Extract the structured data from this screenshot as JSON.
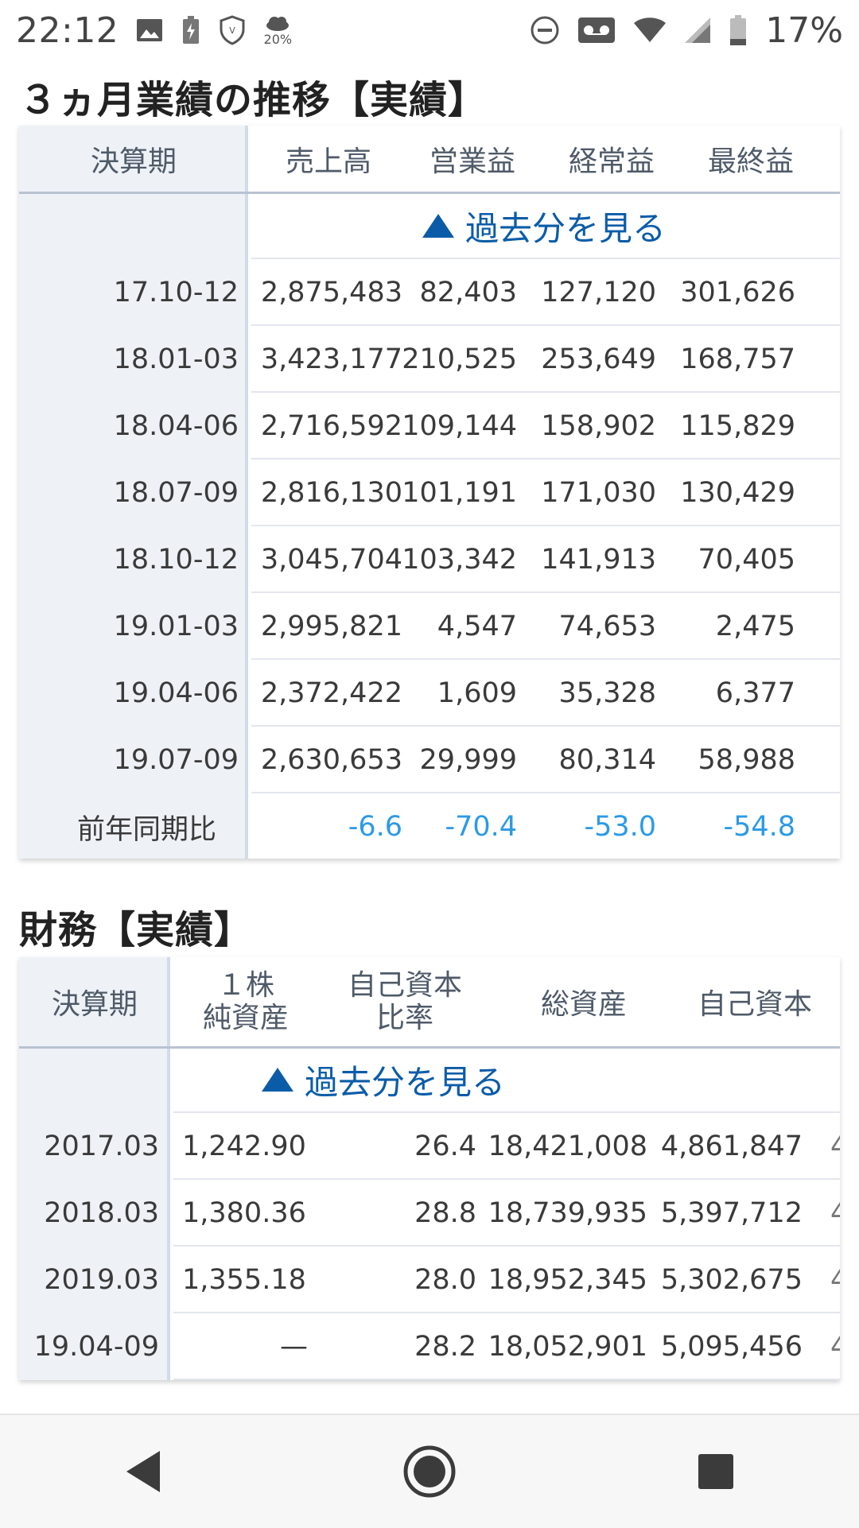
{
  "status": {
    "time": "22:12",
    "battery_pct": "17%",
    "weather_pct": "20%",
    "icons": [
      "image-icon",
      "battery-saver-icon",
      "vpn-shield-icon",
      "weather-icon",
      "dnd-icon",
      "voicemail-icon",
      "wifi-icon",
      "signal-icon",
      "battery-icon"
    ]
  },
  "quarterly": {
    "title": "３ヵ月業績の推移【実績】",
    "headers": [
      "決算期",
      "売上高",
      "営業益",
      "経常益",
      "最終益"
    ],
    "see_past": "過去分を見る",
    "rows": [
      {
        "period": "17.10-12",
        "v": [
          "2,875,483",
          "82,403",
          "127,120",
          "301,626"
        ]
      },
      {
        "period": "18.01-03",
        "v": [
          "3,423,177",
          "210,525",
          "253,649",
          "168,757"
        ]
      },
      {
        "period": "18.04-06",
        "v": [
          "2,716,592",
          "109,144",
          "158,902",
          "115,829"
        ]
      },
      {
        "period": "18.07-09",
        "v": [
          "2,816,130",
          "101,191",
          "171,030",
          "130,429"
        ]
      },
      {
        "period": "18.10-12",
        "v": [
          "3,045,704",
          "103,342",
          "141,913",
          "70,405"
        ]
      },
      {
        "period": "19.01-03",
        "v": [
          "2,995,821",
          "4,547",
          "74,653",
          "2,475"
        ]
      },
      {
        "period": "19.04-06",
        "v": [
          "2,372,422",
          "1,609",
          "35,328",
          "6,377"
        ]
      },
      {
        "period": "19.07-09",
        "v": [
          "2,630,653",
          "29,999",
          "80,314",
          "58,988"
        ]
      }
    ],
    "yoy_label": "前年同期比",
    "yoy": [
      "-6.6",
      "-70.4",
      "-53.0",
      "-54.8"
    ],
    "neg_color": "#2c9ae6"
  },
  "finance": {
    "title": "財務【実績】",
    "headers": [
      "決算期",
      "１株\n純資産",
      "自己資本\n比率",
      "総資産",
      "自己資本"
    ],
    "see_past": "過去分を見る",
    "rows": [
      {
        "period": "2017.03",
        "v": [
          "1,242.90",
          "26.4",
          "18,421,008",
          "4,861,847"
        ]
      },
      {
        "period": "2018.03",
        "v": [
          "1,380.36",
          "28.8",
          "18,739,935",
          "5,397,712"
        ]
      },
      {
        "period": "2019.03",
        "v": [
          "1,355.18",
          "28.0",
          "18,952,345",
          "5,302,675"
        ]
      },
      {
        "period": "19.04-09",
        "v": [
          "—",
          "28.2",
          "18,052,901",
          "5,095,456"
        ]
      }
    ],
    "cut_off_char": "4"
  }
}
